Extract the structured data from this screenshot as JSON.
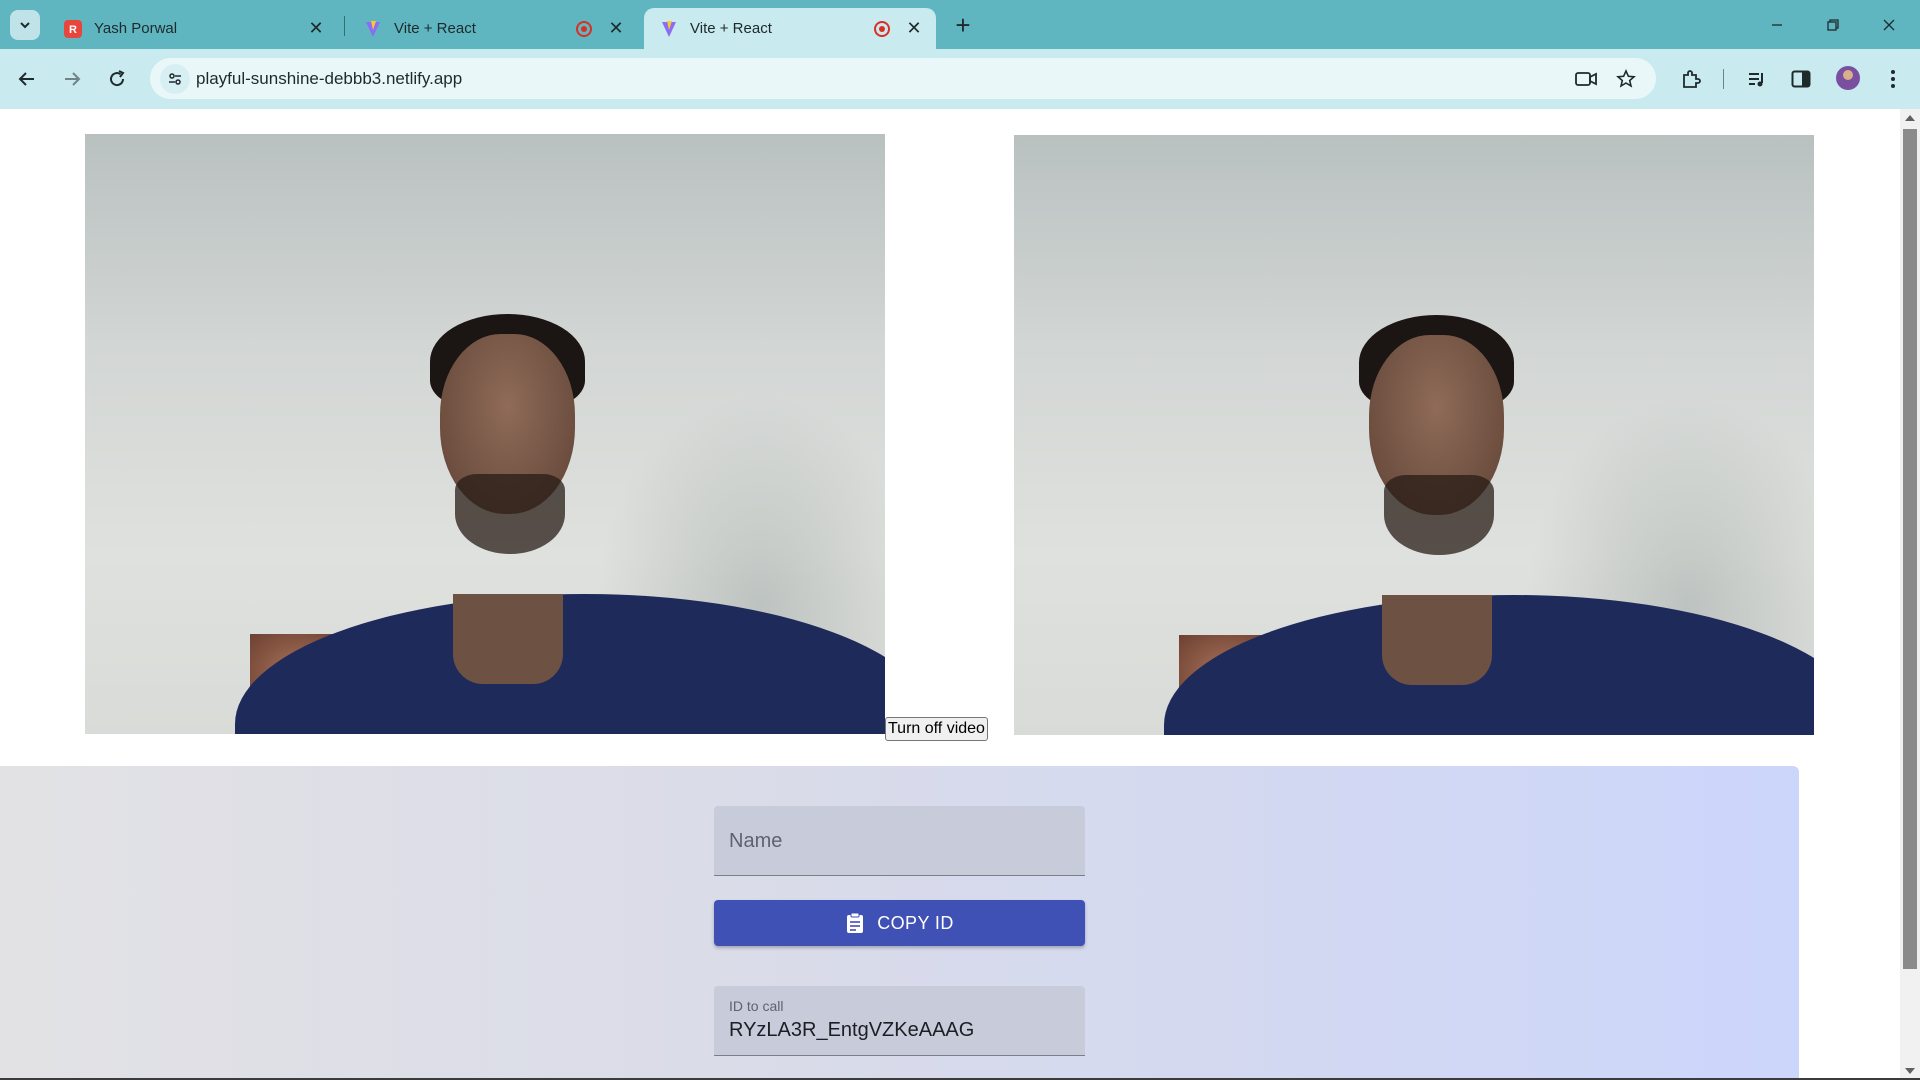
{
  "browser": {
    "tabs": [
      {
        "title": "Yash Porwal",
        "favicon": "red-r-icon",
        "active": false,
        "recording": false
      },
      {
        "title": "Vite + React",
        "favicon": "vite-icon",
        "active": false,
        "recording": true
      },
      {
        "title": "Vite + React",
        "favicon": "vite-icon",
        "active": true,
        "recording": true
      }
    ],
    "url": "playful-sunshine-debbb3.netlify.app",
    "colors": {
      "tabstrip": "#5fb6c1",
      "toolbar": "#c9eaee",
      "record": "#d93025"
    }
  },
  "page": {
    "video_toggle_label": "Turn off video",
    "name_placeholder": "Name",
    "copy_button_label": "COPY ID",
    "id_field_label": "ID to call",
    "id_field_value": "RYzLA3R_EntgVZKeAAAG",
    "colors": {
      "copy_button": "#3f51b5",
      "panel_start": "#e2e2e5",
      "panel_end": "#ccd6fb"
    }
  }
}
